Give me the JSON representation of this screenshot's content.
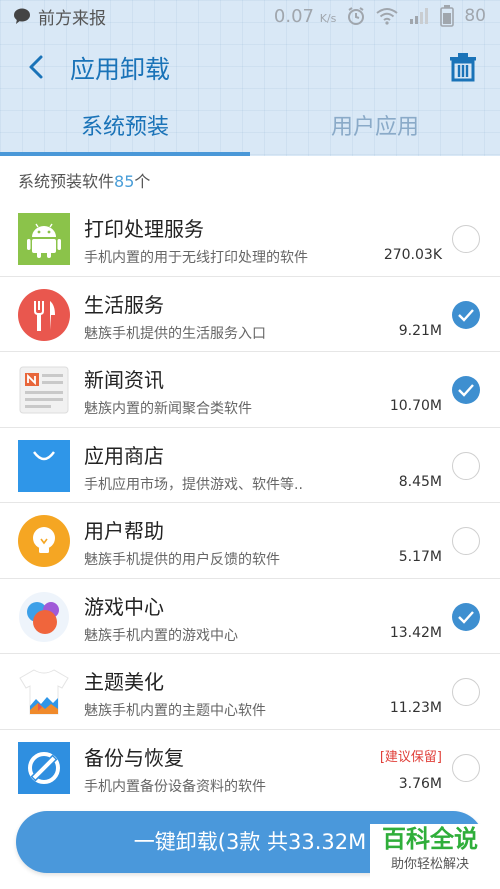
{
  "status_bar": {
    "notification_text": "前方来报",
    "net_speed": "0.07",
    "net_speed_unit": "K/s",
    "battery": "80"
  },
  "app_bar": {
    "title": "应用卸载"
  },
  "tabs": [
    {
      "label": "系统预装",
      "active": true
    },
    {
      "label": "用户应用",
      "active": false
    }
  ],
  "summary": {
    "prefix": "系统预装软件",
    "count": "85",
    "suffix": "个"
  },
  "apps": [
    {
      "name": "打印处理服务",
      "desc": "手机内置的用于无线打印处理的软件",
      "size": "270.03K",
      "checked": false,
      "icon": "android-icon"
    },
    {
      "name": "生活服务",
      "desc": "魅族手机提供的生活服务入口",
      "size": "9.21M",
      "checked": true,
      "icon": "fork-knife-icon"
    },
    {
      "name": "新闻资讯",
      "desc": "魅族内置的新闻聚合类软件",
      "size": "10.70M",
      "checked": true,
      "icon": "newspaper-icon"
    },
    {
      "name": "应用商店",
      "desc": "手机应用市场，提供游戏、软件等..",
      "size": "8.45M",
      "checked": false,
      "icon": "shopping-bag-icon"
    },
    {
      "name": "用户帮助",
      "desc": "魅族手机提供的用户反馈的软件",
      "size": "5.17M",
      "checked": false,
      "icon": "lightbulb-icon"
    },
    {
      "name": "游戏中心",
      "desc": "魅族手机内置的游戏中心",
      "size": "13.42M",
      "checked": true,
      "icon": "game-bubbles-icon"
    },
    {
      "name": "主题美化",
      "desc": "魅族手机内置的主题中心软件",
      "size": "11.23M",
      "checked": false,
      "icon": "tshirt-icon"
    },
    {
      "name": "备份与恢复",
      "desc": "手机内置备份设备资料的软件",
      "size": "3.76M",
      "checked": false,
      "icon": "backup-restore-icon",
      "tag": "[建议保留]"
    }
  ],
  "uninstall_button": {
    "label": "一键卸载(3款 共33.32M"
  },
  "watermark": {
    "main": "百科全说",
    "sub": "助你轻松解决"
  },
  "colors": {
    "accent": "#4a98db",
    "title": "#1a73b8",
    "warning": "#e0413b",
    "header_bg": "#d9e8f6"
  }
}
